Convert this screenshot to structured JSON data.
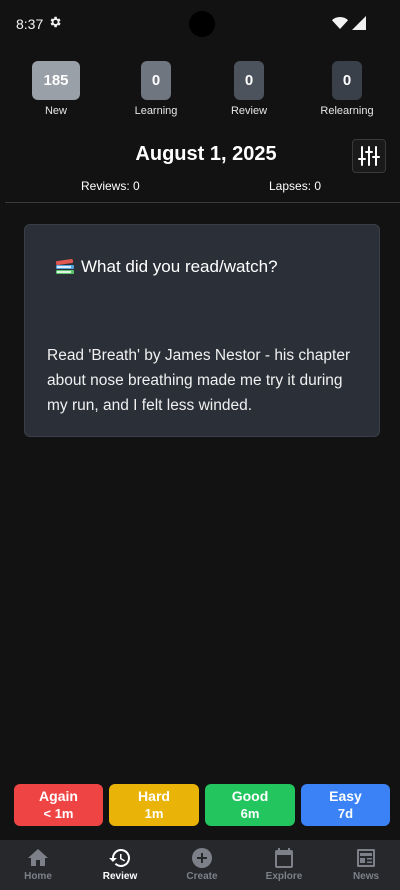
{
  "status_bar": {
    "time": "8:37"
  },
  "counters": [
    {
      "value": "185",
      "label": "New"
    },
    {
      "value": "0",
      "label": "Learning"
    },
    {
      "value": "0",
      "label": "Review"
    },
    {
      "value": "0",
      "label": "Relearning"
    }
  ],
  "header": {
    "date": "August 1, 2025",
    "reviews": "Reviews: 0",
    "lapses": "Lapses: 0"
  },
  "card": {
    "question": "What did you read/watch?",
    "answer": "Read 'Breath' by James Nestor - his chapter about nose breathing made me try it during my run, and I felt less winded."
  },
  "answer_buttons": [
    {
      "label": "Again",
      "interval": "< 1m",
      "color": "#ef4444"
    },
    {
      "label": "Hard",
      "interval": "1m",
      "color": "#eab308"
    },
    {
      "label": "Good",
      "interval": "6m",
      "color": "#22c55e"
    },
    {
      "label": "Easy",
      "interval": "7d",
      "color": "#3b82f6"
    }
  ],
  "nav": [
    {
      "label": "Home",
      "icon": "home-icon"
    },
    {
      "label": "Review",
      "icon": "history-icon",
      "active": true
    },
    {
      "label": "Create",
      "icon": "add-circle-icon"
    },
    {
      "label": "Explore",
      "icon": "calendar-icon"
    },
    {
      "label": "News",
      "icon": "newspaper-icon"
    }
  ]
}
